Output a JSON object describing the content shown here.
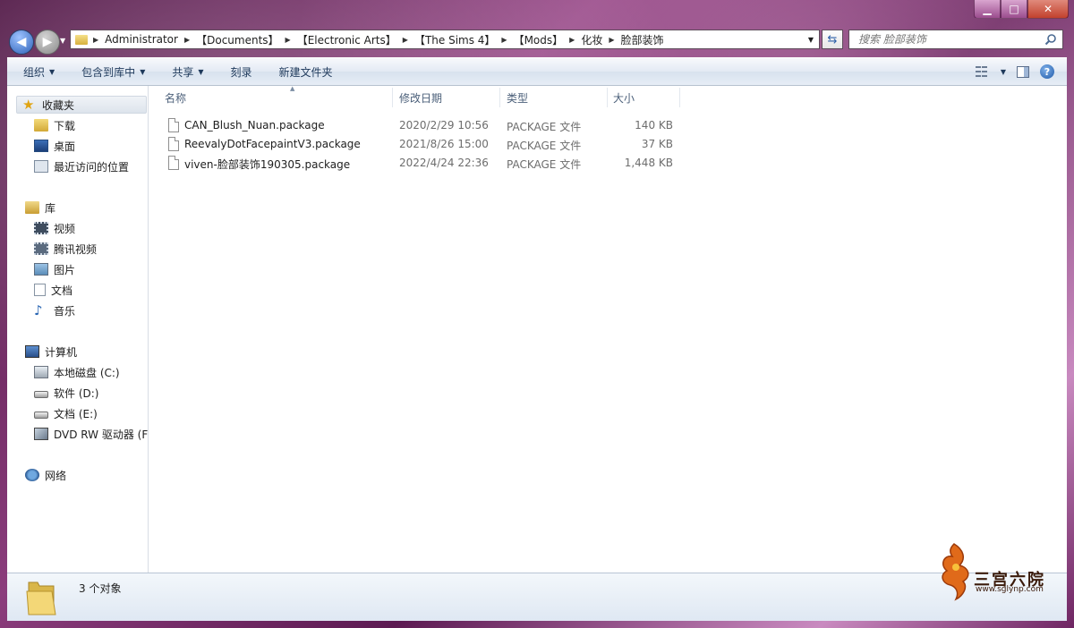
{
  "window": {
    "minimize_icon": "minimize-icon",
    "maximize_icon": "maximize-icon",
    "close_icon": "close-icon"
  },
  "address": {
    "crumbs": [
      "Administrator",
      "【Documents】",
      "【Electronic Arts】",
      "【The Sims 4】",
      "【Mods】",
      "化妆",
      "脸部装饰"
    ]
  },
  "search": {
    "placeholder": "搜索 脸部装饰"
  },
  "toolbar": {
    "organize": "组织",
    "include_in_library": "包含到库中",
    "share": "共享",
    "burn": "刻录",
    "new_folder": "新建文件夹"
  },
  "nav": {
    "favorites": {
      "title": "收藏夹",
      "items": [
        "下载",
        "桌面",
        "最近访问的位置"
      ]
    },
    "libraries": {
      "title": "库",
      "items": [
        "视频",
        "腾讯视频",
        "图片",
        "文档",
        "音乐"
      ]
    },
    "computer": {
      "title": "计算机",
      "items": [
        "本地磁盘 (C:)",
        "软件 (D:)",
        "文档 (E:)",
        "DVD RW 驱动器 (F:"
      ]
    },
    "network": {
      "title": "网络"
    }
  },
  "columns": {
    "name": "名称",
    "modified": "修改日期",
    "type": "类型",
    "size": "大小"
  },
  "files": [
    {
      "name": "CAN_Blush_Nuan.package",
      "modified": "2020/2/29 10:56",
      "type": "PACKAGE 文件",
      "size": "140 KB"
    },
    {
      "name": "ReevalyDotFacepaintV3.package",
      "modified": "2021/8/26 15:00",
      "type": "PACKAGE 文件",
      "size": "37 KB"
    },
    {
      "name": "viven-脸部装饰190305.package",
      "modified": "2022/4/24 22:36",
      "type": "PACKAGE 文件",
      "size": "1,448 KB"
    }
  ],
  "status": {
    "count": "3 个对象"
  },
  "watermark": {
    "text": "三宫六院",
    "url": "www.sglynp.com"
  },
  "colors": {
    "accent": "#2e62b8",
    "frame": "#8b3d7c"
  }
}
